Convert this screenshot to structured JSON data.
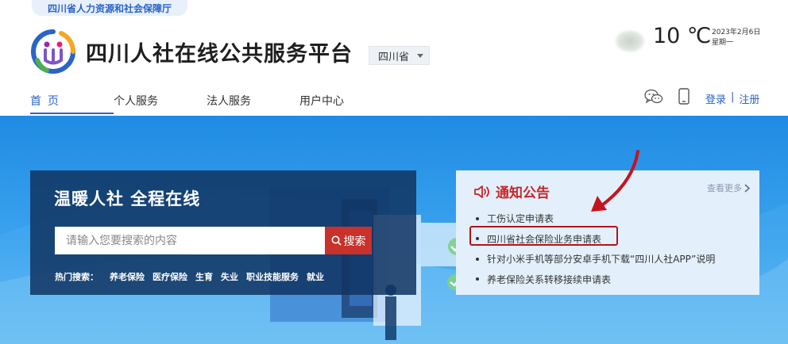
{
  "header": {
    "department": "四川省人力资源和社会保障厅",
    "title": "四川人社在线公共服务平台",
    "province": "四川省"
  },
  "weather": {
    "temperature": "10 ℃",
    "date": "2023年2月6日",
    "weekday": "星期一",
    "icon": "cloud-icon"
  },
  "nav": {
    "items": [
      {
        "label": "首页",
        "active": true
      },
      {
        "label": "个人服务",
        "active": false
      },
      {
        "label": "法人服务",
        "active": false
      },
      {
        "label": "用户中心",
        "active": false
      }
    ]
  },
  "auth": {
    "login": "登录",
    "separator": "|",
    "register": "注册"
  },
  "search": {
    "slogan": "温暖人社 全程在线",
    "placeholder": "请输入您要搜索的内容",
    "button_label": "搜索",
    "hot_label": "热门搜索：",
    "hot_terms": [
      "养老保险",
      "医疗保险",
      "生育",
      "失业",
      "职业技能服务",
      "就业"
    ]
  },
  "notice": {
    "title": "通知公告",
    "more_label": "查看更多",
    "items": [
      "工伤认定申请表",
      "四川省社会保险业务申请表",
      "针对小米手机等部分安卓手机下载“四川人社APP”说明",
      "养老保险关系转移接续申请表"
    ]
  },
  "colors": {
    "brand_blue": "#2a64c8",
    "search_red": "#c9312b",
    "notice_red": "#c62828",
    "highlight": "#b3131b"
  }
}
